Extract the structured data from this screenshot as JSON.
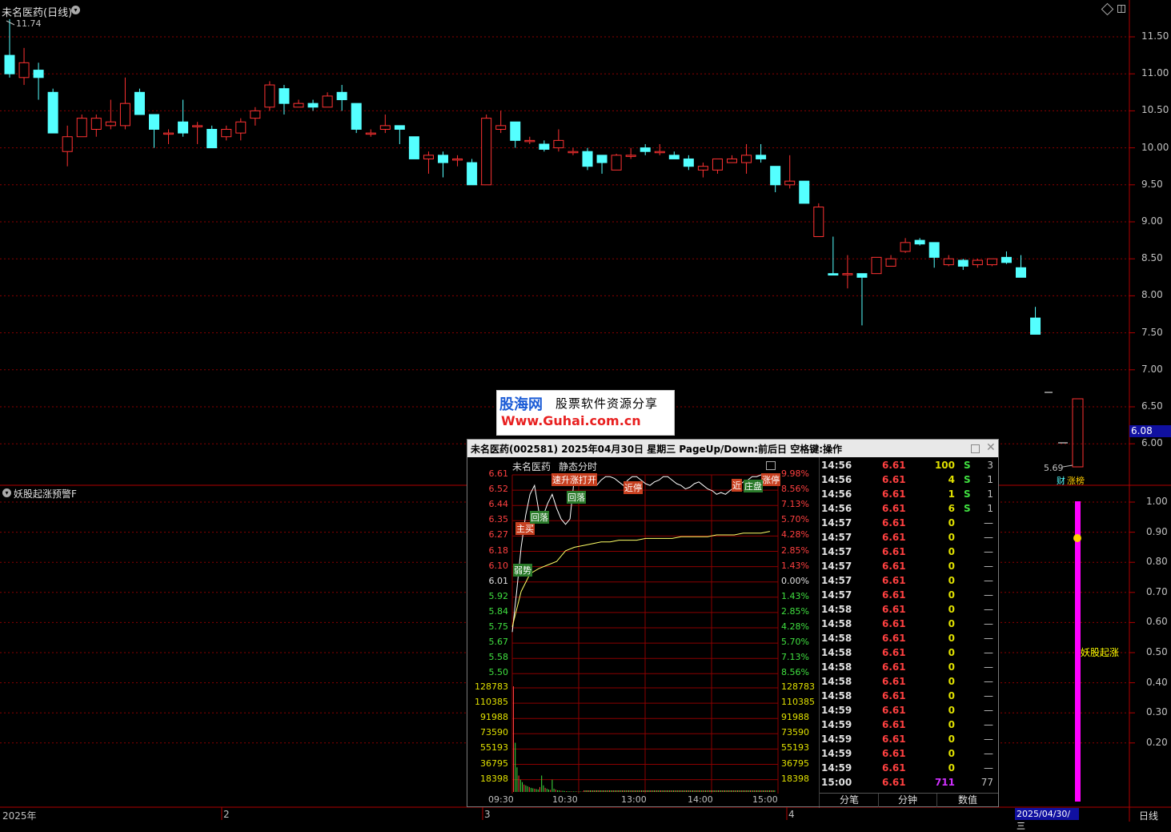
{
  "main_chart": {
    "title": "未名医药(日线)",
    "high_label": "11.74",
    "low_label": "5.69",
    "current_price": "6.08",
    "y_ticks": [
      "11.50",
      "11.00",
      "10.50",
      "10.00",
      "9.50",
      "9.00",
      "8.50",
      "8.00",
      "7.50",
      "7.00",
      "6.50",
      "6.00"
    ],
    "x_labels": [
      "2025年",
      "2",
      "3",
      "4"
    ],
    "selected_date": "2025/04/30/三",
    "period_button": "日线",
    "tags": [
      "财",
      "涨榜"
    ]
  },
  "indicator": {
    "title": "妖股起涨预警F",
    "y_ticks": [
      "1.00",
      "0.90",
      "0.80",
      "0.70",
      "0.60",
      "0.50",
      "0.40",
      "0.30",
      "0.20"
    ],
    "bar_label": "妖股起涨"
  },
  "watermark": {
    "brand": "股海网",
    "tagline": "股票软件资源分享",
    "url": "Www.Guhai.com.cn"
  },
  "popup": {
    "title": "未名医药(002581)  2025年04月30日 星期三  PageUp/Down:前后日 空格键:操作",
    "chart_name": "未名医药",
    "chart_mode": "静态分时",
    "price_labels": [
      "6.61",
      "6.52",
      "6.44",
      "6.35",
      "6.27",
      "6.18",
      "6.10",
      "6.01",
      "5.92",
      "5.84",
      "5.75",
      "5.67",
      "5.58",
      "5.50"
    ],
    "pct_labels": [
      "9.98%",
      "8.56%",
      "7.13%",
      "5.70%",
      "4.28%",
      "2.85%",
      "1.43%",
      "0.00%",
      "1.43%",
      "2.85%",
      "4.28%",
      "5.70%",
      "7.13%",
      "8.56%"
    ],
    "vol_labels": [
      "128783",
      "110385",
      "91988",
      "73590",
      "55193",
      "36795",
      "18398"
    ],
    "time_labels": [
      "09:30",
      "10:30",
      "13:00",
      "14:00",
      "15:00"
    ],
    "signals": [
      "速升涨打开",
      "近停",
      "回落",
      "弱势",
      "主买",
      "回落",
      "涨停",
      "近",
      "庄盘"
    ],
    "ticks": [
      {
        "time": "14:56",
        "price": "6.61",
        "vol": "100",
        "flag": "S",
        "n": "3"
      },
      {
        "time": "14:56",
        "price": "6.61",
        "vol": "4",
        "flag": "S",
        "n": "1"
      },
      {
        "time": "14:56",
        "price": "6.61",
        "vol": "1",
        "flag": "S",
        "n": "1"
      },
      {
        "time": "14:56",
        "price": "6.61",
        "vol": "6",
        "flag": "S",
        "n": "1"
      },
      {
        "time": "14:57",
        "price": "6.61",
        "vol": "0",
        "flag": "",
        "n": "—"
      },
      {
        "time": "14:57",
        "price": "6.61",
        "vol": "0",
        "flag": "",
        "n": "—"
      },
      {
        "time": "14:57",
        "price": "6.61",
        "vol": "0",
        "flag": "",
        "n": "—"
      },
      {
        "time": "14:57",
        "price": "6.61",
        "vol": "0",
        "flag": "",
        "n": "—"
      },
      {
        "time": "14:57",
        "price": "6.61",
        "vol": "0",
        "flag": "",
        "n": "—"
      },
      {
        "time": "14:57",
        "price": "6.61",
        "vol": "0",
        "flag": "",
        "n": "—"
      },
      {
        "time": "14:58",
        "price": "6.61",
        "vol": "0",
        "flag": "",
        "n": "—"
      },
      {
        "time": "14:58",
        "price": "6.61",
        "vol": "0",
        "flag": "",
        "n": "—"
      },
      {
        "time": "14:58",
        "price": "6.61",
        "vol": "0",
        "flag": "",
        "n": "—"
      },
      {
        "time": "14:58",
        "price": "6.61",
        "vol": "0",
        "flag": "",
        "n": "—"
      },
      {
        "time": "14:58",
        "price": "6.61",
        "vol": "0",
        "flag": "",
        "n": "—"
      },
      {
        "time": "14:58",
        "price": "6.61",
        "vol": "0",
        "flag": "",
        "n": "—"
      },
      {
        "time": "14:58",
        "price": "6.61",
        "vol": "0",
        "flag": "",
        "n": "—"
      },
      {
        "time": "14:59",
        "price": "6.61",
        "vol": "0",
        "flag": "",
        "n": "—"
      },
      {
        "time": "14:59",
        "price": "6.61",
        "vol": "0",
        "flag": "",
        "n": "—"
      },
      {
        "time": "14:59",
        "price": "6.61",
        "vol": "0",
        "flag": "",
        "n": "—"
      },
      {
        "time": "14:59",
        "price": "6.61",
        "vol": "0",
        "flag": "",
        "n": "—"
      },
      {
        "time": "14:59",
        "price": "6.61",
        "vol": "0",
        "flag": "",
        "n": "—"
      },
      {
        "time": "15:00",
        "price": "6.61",
        "vol": "711",
        "flag": "",
        "n": "77"
      }
    ],
    "tabs": [
      "分笔",
      "分钟",
      "数值"
    ]
  },
  "colors": {
    "up": "#ff3232",
    "down": "#54ffff",
    "grid": "#8b0000",
    "border": "#b00000",
    "magenta": "#ff00ff",
    "yellow": "#ffff00"
  }
}
